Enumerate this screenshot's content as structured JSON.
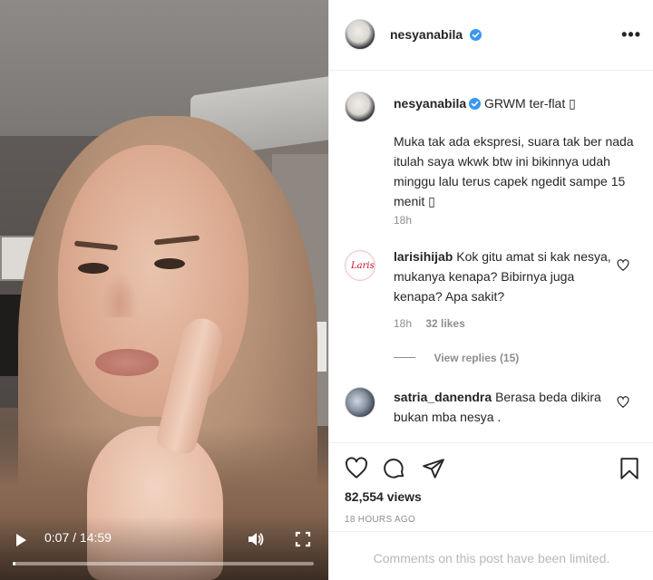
{
  "video": {
    "current_time": "0:07",
    "separator": "/",
    "duration": "14:59",
    "progress_fraction": 0.008
  },
  "post": {
    "author": "nesyanabila",
    "verified": true,
    "caption_title": "GRWM ter-flat",
    "caption_body": "Muka tak ada ekspresi, suara tak ber nada itulah saya wkwk btw ini bikinnya udah minggu lalu terus capek ngedit sampe 15 menit",
    "placeholder_glyph": "▯",
    "caption_age": "18h"
  },
  "comments": [
    {
      "username": "larisihijab",
      "avatar_text": "Larisi",
      "text": "Kok gitu amat si kak nesya, mukanya kenapa? Bibirnya juga kenapa? Apa sakit?",
      "age": "18h",
      "likes": "32 likes",
      "view_replies": "View replies (15)"
    },
    {
      "username": "satria_danendra",
      "text": "Berasa beda dikira bukan mba nesya ."
    }
  ],
  "actions": {
    "views": "82,554 views",
    "posted_ago": "18 HOURS AGO"
  },
  "footer": {
    "limited_notice": "Comments on this post have been limited."
  },
  "icons": {
    "play": "play-icon",
    "volume": "volume-icon",
    "fullscreen": "fullscreen-icon",
    "more": "more-options-icon",
    "verified": "verified-badge-icon",
    "like": "heart-icon",
    "comment": "comment-icon",
    "share": "share-icon",
    "save": "bookmark-icon"
  },
  "colors": {
    "verified_blue": "#3897f0",
    "text_primary": "#262626",
    "text_secondary": "#8e8e8e",
    "divider": "#efefef"
  }
}
